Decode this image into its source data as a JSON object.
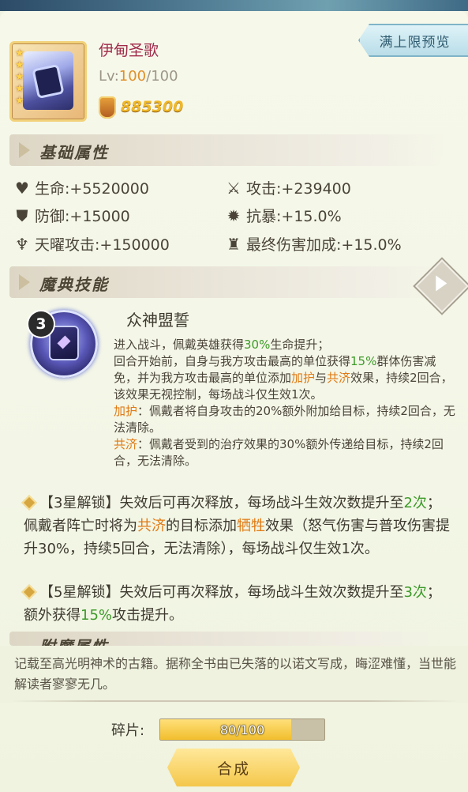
{
  "header": {
    "preview_button": "满上限预览"
  },
  "item": {
    "name": "伊甸圣歌",
    "level_prefix": "Lv:",
    "level_current": "100",
    "level_max": "/100",
    "power": "885300",
    "stars": 5
  },
  "base_attributes": {
    "title": "基础属性",
    "stats": [
      {
        "label": "生命:+5520000",
        "icon": "heart-icon"
      },
      {
        "label": "攻击:+239400",
        "icon": "sword-icon"
      },
      {
        "label": "防御:+15000",
        "icon": "shield-icon"
      },
      {
        "label": "抗暴:+15.0%",
        "icon": "crit-resist-icon"
      },
      {
        "label": "天曜攻击:+150000",
        "icon": "sky-attack-icon"
      },
      {
        "label": "最终伤害加成:+15.0%",
        "icon": "final-damage-icon"
      }
    ]
  },
  "skill_section": {
    "title": "魔典技能",
    "skill_level": "3",
    "skill_name": "众神盟誓",
    "desc": {
      "l1a": "进入战斗，佩戴英雄获得",
      "l1b": "30%",
      "l1c": "生命提升；",
      "l2a": "回合开始前，自身与我方攻击最高的单位获得",
      "l2b": "15%",
      "l2c": "群体伤害减免，并为我方攻击最高的单位添加",
      "l2d": "加护",
      "l2e": "与",
      "l2f": "共济",
      "l2g": "效果，持续2回合，该效果无视控制，每场战斗仅生效1次。",
      "l3a": "加护",
      "l3b": "：佩戴者将自身攻击的20%额外附加给目标，持续2回合，无法清除。",
      "l4a": "共济",
      "l4b": "：佩戴者受到的治疗效果的30%额外传递给目标，持续2回合，无法清除。"
    },
    "unlock3": {
      "a": "【3星解锁】失效后可再次释放，每场战斗生效次数提升至",
      "b": "2次",
      "c": "；佩戴者阵亡时将为",
      "d": "共济",
      "e": "的目标添加",
      "f": "牺牲",
      "g": "效果（怒气伤害与普攻伤害提升30%，持续5回合，无法清除），每场战斗仅生效1次。"
    },
    "unlock5": {
      "a": "【5星解锁】失效后可再次释放，每场战斗生效次数提升至",
      "b": "3次",
      "c": "；额外获得",
      "d": "15%",
      "e": "攻击提升。"
    }
  },
  "enchant_section": {
    "title": "附魔属性"
  },
  "flavor_text": "记载至高光明神术的古籍。据称全书由已失落的以诺文写成，晦涩难懂，当世能解读者寥寥无几。",
  "shards": {
    "label": "碎片:",
    "progress_text": "80/100",
    "progress_fraction": 0.8
  },
  "synth_button": "合成",
  "colors": {
    "highlight_green": "#3d9a2a",
    "highlight_orange": "#e07a14",
    "item_name": "#a02c4a",
    "level_current": "#e0902a",
    "power": "#f0b92a"
  }
}
